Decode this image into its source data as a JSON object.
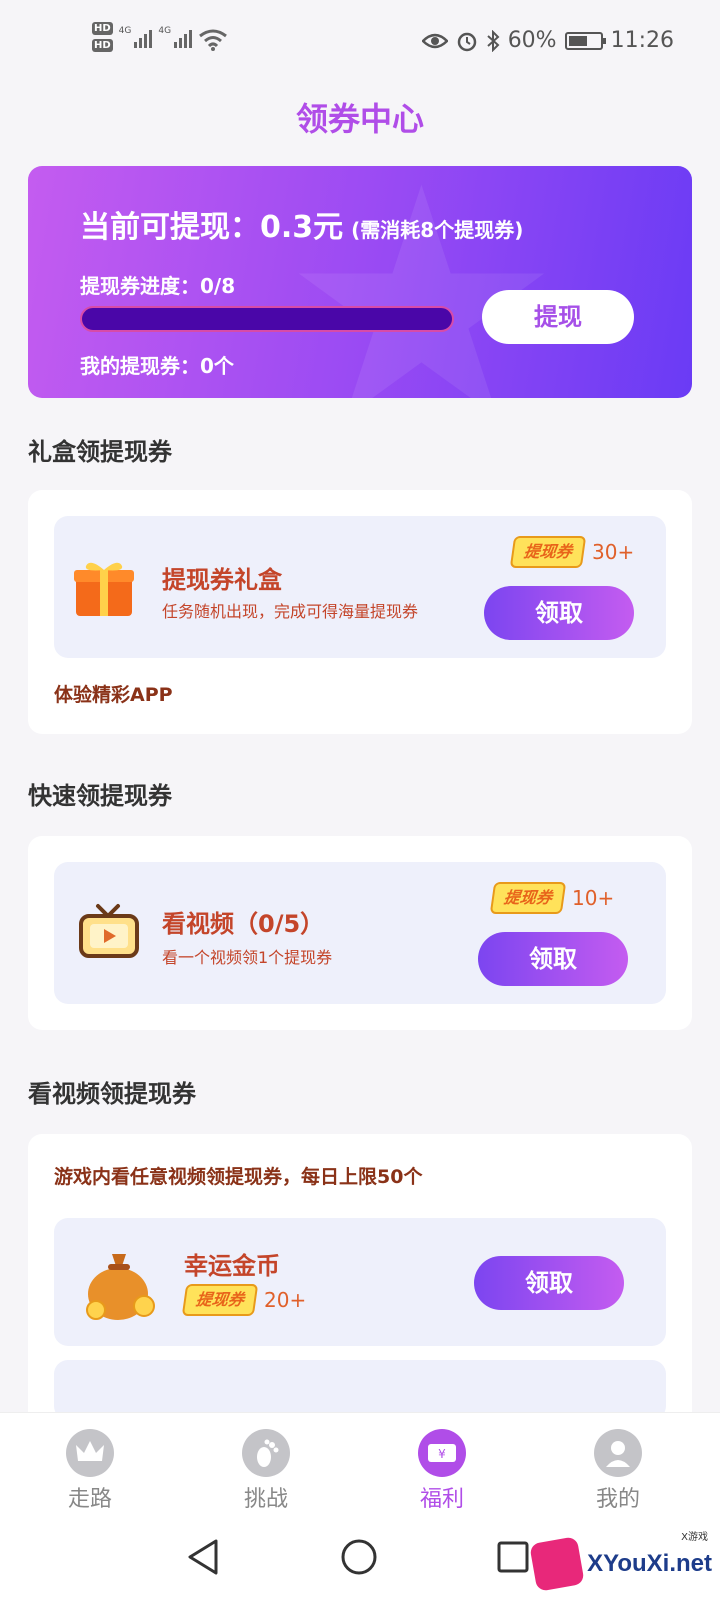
{
  "status_bar": {
    "hd1": "HD",
    "hd2": "HD",
    "net1": "4G",
    "net2": "4G",
    "battery": "60%",
    "time": "11:26"
  },
  "page": {
    "title": "领券中心"
  },
  "hero": {
    "amount_text": "当前可提现：0.3元",
    "amount_note": "(需消耗8个提现券)",
    "progress_label": "提现券进度：0/8",
    "progress_value": 0,
    "progress_total": 8,
    "my_tickets": "我的提现券：0个",
    "withdraw_button": "提现"
  },
  "section_gift": {
    "title": "礼盒领提现券",
    "task": {
      "title": "提现券礼盒",
      "desc": "任务随机出现，完成可得海量提现券",
      "ticket_label": "提现券",
      "count": "30+",
      "button": "领取"
    },
    "note": "体验精彩APP"
  },
  "section_quick": {
    "title": "快速领提现券",
    "task": {
      "title": "看视频（0/5）",
      "desc": "看一个视频领1个提现券",
      "ticket_label": "提现券",
      "count": "10+",
      "button": "领取"
    }
  },
  "section_video": {
    "title": "看视频领提现券",
    "note": "游戏内看任意视频领提现券，每日上限50个",
    "task": {
      "title": "幸运金币",
      "ticket_label": "提现券",
      "count": "20+",
      "button": "领取"
    }
  },
  "bottom_nav": {
    "items": [
      {
        "label": "走路",
        "icon": "crown-icon"
      },
      {
        "label": "挑战",
        "icon": "footprint-icon"
      },
      {
        "label": "福利",
        "icon": "ticket-icon",
        "active": true
      },
      {
        "label": "我的",
        "icon": "user-icon"
      }
    ]
  },
  "watermark": {
    "text": "XYouXi.net",
    "sub": "X游戏"
  },
  "colors": {
    "accent": "#b04de8",
    "hero_start": "#c45cf0",
    "hero_end": "#6a3bf5",
    "task_text": "#c4452a"
  }
}
